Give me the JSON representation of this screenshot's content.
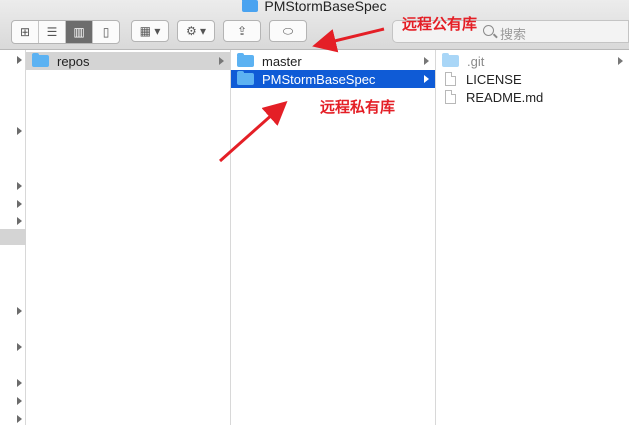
{
  "window": {
    "title": "PMStormBaseSpec"
  },
  "toolbar": {
    "view_modes": [
      "icon-view",
      "list-view",
      "column-view",
      "cover-flow-view"
    ],
    "active_view": "column-view",
    "arrange_icon": "grid-arrange-icon",
    "action_icon": "gear-icon",
    "share_icon": "share-icon",
    "tag_icon": "tag-icon",
    "search_placeholder": "搜索"
  },
  "columns": {
    "col1": [
      {
        "label": "repos",
        "kind": "folder",
        "selected": "inactive",
        "has_children": true
      }
    ],
    "col2": [
      {
        "label": "master",
        "kind": "folder",
        "selected": "none",
        "has_children": true
      },
      {
        "label": "PMStormBaseSpec",
        "kind": "folder",
        "selected": "active",
        "has_children": true
      }
    ],
    "col3": [
      {
        "label": ".git",
        "kind": "folder-dim",
        "has_children": true
      },
      {
        "label": "LICENSE",
        "kind": "file",
        "has_children": false
      },
      {
        "label": "README.md",
        "kind": "file",
        "has_children": false
      }
    ]
  },
  "annotations": {
    "public_repo": "远程公有库",
    "private_repo": "远程私有库"
  },
  "colors": {
    "selection": "#0f5bd6",
    "annotation": "#e41f26",
    "folder": "#5cb2f2"
  }
}
